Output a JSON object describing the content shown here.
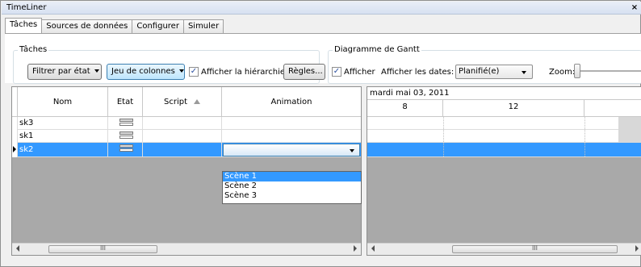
{
  "window": {
    "title": "TimeLiner",
    "close_glyph": "×"
  },
  "tabs": [
    {
      "label": "Tâches",
      "active": true
    },
    {
      "label": "Sources de données",
      "active": false
    },
    {
      "label": "Configurer",
      "active": false
    },
    {
      "label": "Simuler",
      "active": false
    }
  ],
  "tasks_group": {
    "label": "Tâches",
    "filter_button": "Filtrer par état",
    "columns_button": "Jeu de colonnes",
    "show_hierarchy": {
      "label": "Afficher la hiérarchie",
      "checked": true
    },
    "rules_button": "Règles..."
  },
  "gantt_group": {
    "label": "Diagramme de Gantt",
    "show": {
      "label": "Afficher",
      "checked": true
    },
    "dates_label": "Afficher les dates:",
    "dates_value": "Planifié(e)",
    "zoom_label": "Zoom:",
    "zoom_level": 0
  },
  "grid": {
    "columns": [
      "Nom",
      "Etat",
      "Script",
      "Animation"
    ],
    "rows": [
      {
        "name": "sk3",
        "selected": false
      },
      {
        "name": "sk1",
        "selected": false
      },
      {
        "name": "sk2",
        "selected": true
      }
    ],
    "animation_options": [
      "Scène 1",
      "Scène 2",
      "Scène 3"
    ],
    "highlighted_option": "Scène 1",
    "scroll_thumb_glyph": "III"
  },
  "gantt": {
    "date_header": "mardi mai 03, 2011",
    "day_columns": [
      "8",
      "12"
    ],
    "scroll_thumb_glyph": "III"
  },
  "colors": {
    "selection": "#3399ff",
    "background_dark": "#a9a9a9"
  }
}
